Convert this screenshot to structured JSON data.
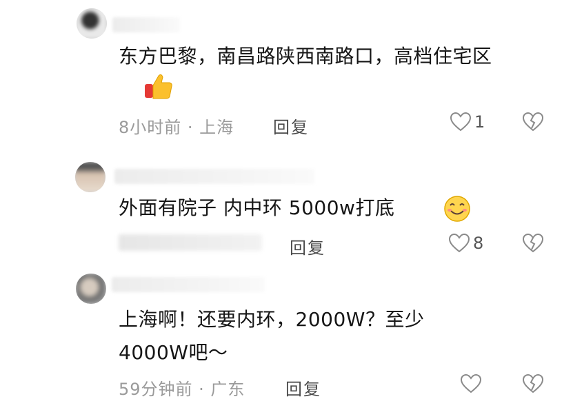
{
  "comments": [
    {
      "text": "东方巴黎，南昌路陕西南路口，高档住宅区",
      "emoji": "thumbs-up",
      "time_location": "8小时前 · 上海",
      "reply_label": "回复",
      "like_count": "1"
    },
    {
      "text": "外面有院子  内中环  5000w打底",
      "emoji": "smile",
      "time_location": "",
      "reply_label": "回复",
      "like_count": "8"
    },
    {
      "text": "上海啊！还要内环，2000W？至少4000W吧～",
      "emoji": "",
      "time_location": "59分钟前 · 广东",
      "reply_label": "回复",
      "like_count": ""
    }
  ],
  "colors": {
    "meta_text": "#9a9a9a",
    "icon_stroke": "#8a8a8a",
    "body_text": "#161616"
  },
  "icons": [
    "heart-icon",
    "broken-heart-icon",
    "thumbs-up-emoji",
    "smile-emoji"
  ]
}
